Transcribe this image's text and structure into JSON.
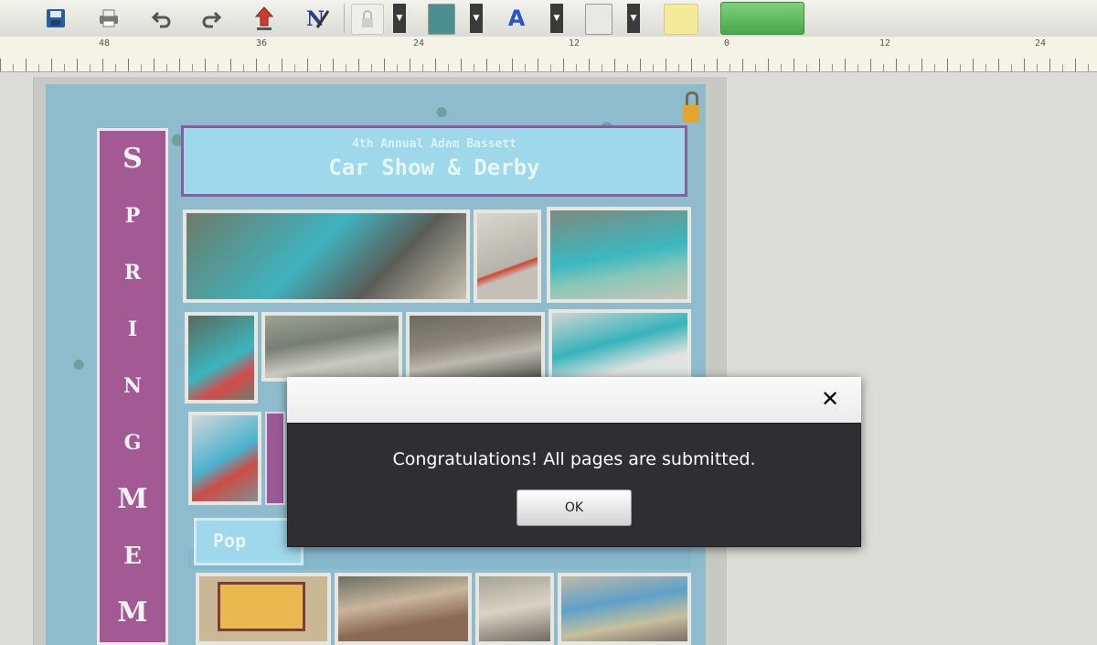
{
  "toolbar": {
    "icons": [
      "save-icon",
      "print-icon",
      "undo-icon",
      "redo-icon",
      "upload-icon",
      "edit-text-icon",
      "lock-icon",
      "fill-color-icon",
      "text-color-icon",
      "page-color-icon"
    ],
    "done_label": ""
  },
  "ruler": {
    "numbers": [
      "48",
      "36",
      "24",
      "12",
      "0",
      "12",
      "24"
    ]
  },
  "page": {
    "side_banner_letters": [
      "S",
      "P",
      "R",
      "I",
      "N",
      "G",
      "M",
      "E",
      "M"
    ],
    "title_small": "4th Annual Adam Bassett",
    "title_big": "Car Show & Derby",
    "pop_label": "Pop"
  },
  "dialog": {
    "close_label": "✕",
    "message": "Congratulations! All pages are submitted.",
    "ok_label": "OK"
  },
  "colors": {
    "dialog_body": "#2f2f33",
    "banner_purple": "#a35a94",
    "title_bg": "#9fd8ea",
    "done_green": "#49a84a"
  }
}
